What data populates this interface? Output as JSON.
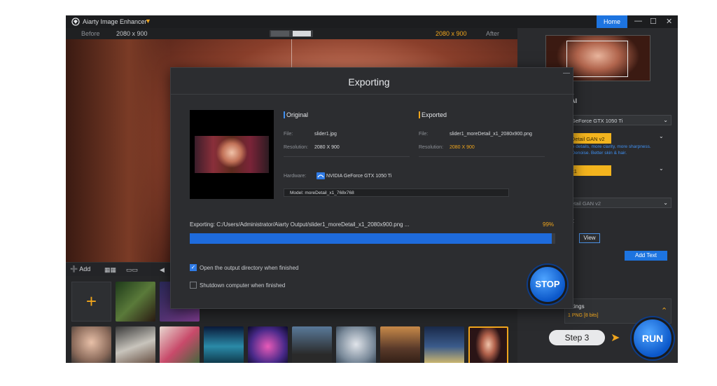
{
  "titlebar": {
    "app_title": "Aiarty Image Enhancer",
    "home_label": "Home"
  },
  "compare": {
    "before_label": "Before",
    "before_resolution": "2080 x 900",
    "after_resolution": "2080 x 900",
    "after_label": "After"
  },
  "thumb_toolbar": {
    "add_label": "Add"
  },
  "right_panel": {
    "ai_section": "AI",
    "gpu_select": "GeForce GTX 1050 Ti",
    "model_select": "Detail GAN v2",
    "model_note_1": "ore details, more clarity, more sharpness.",
    "model_note_2": "+ Denoise. Better skin & hair.",
    "scale_select": "x1",
    "secondary_model": "etail GAN v2",
    "output_section": "pt",
    "view_label": "View",
    "add_text_label": "Add Text",
    "settings_title": "ettings",
    "settings_format": "1  PNG  [8 bits]",
    "step_label": "Step 3",
    "run_label": "RUN"
  },
  "modal": {
    "title": "Exporting",
    "original": {
      "heading": "Original",
      "file_label": "File:",
      "file_value": "slider1.jpg",
      "resolution_label": "Resolution:",
      "resolution_value": "2080 X 900"
    },
    "exported": {
      "heading": "Exported",
      "file_label": "File:",
      "file_value": "slider1_moreDetail_x1_2080x900.png",
      "resolution_label": "Resolution:",
      "resolution_value": "2080 X 900"
    },
    "hardware_label": "Hardware:",
    "hardware_value": "NVIDIA GeForce GTX 1050 Ti",
    "model_label": "Model: moreDetail_x1_768x768",
    "export_path": "Exporting: C:/Users/Administrator/Aiarty Output/slider1_moreDetail_x1_2080x900.png ...",
    "progress_text": "99%",
    "progress_fraction": 0.99,
    "open_dir_label": "Open the output directory when finished",
    "open_dir_checked": true,
    "shutdown_label": "Shutdown computer when finished",
    "shutdown_checked": false,
    "stop_label": "STOP"
  },
  "colors": {
    "accent": "#1d74e0",
    "orange": "#f0a51c",
    "progress": "#1e6bdc"
  }
}
